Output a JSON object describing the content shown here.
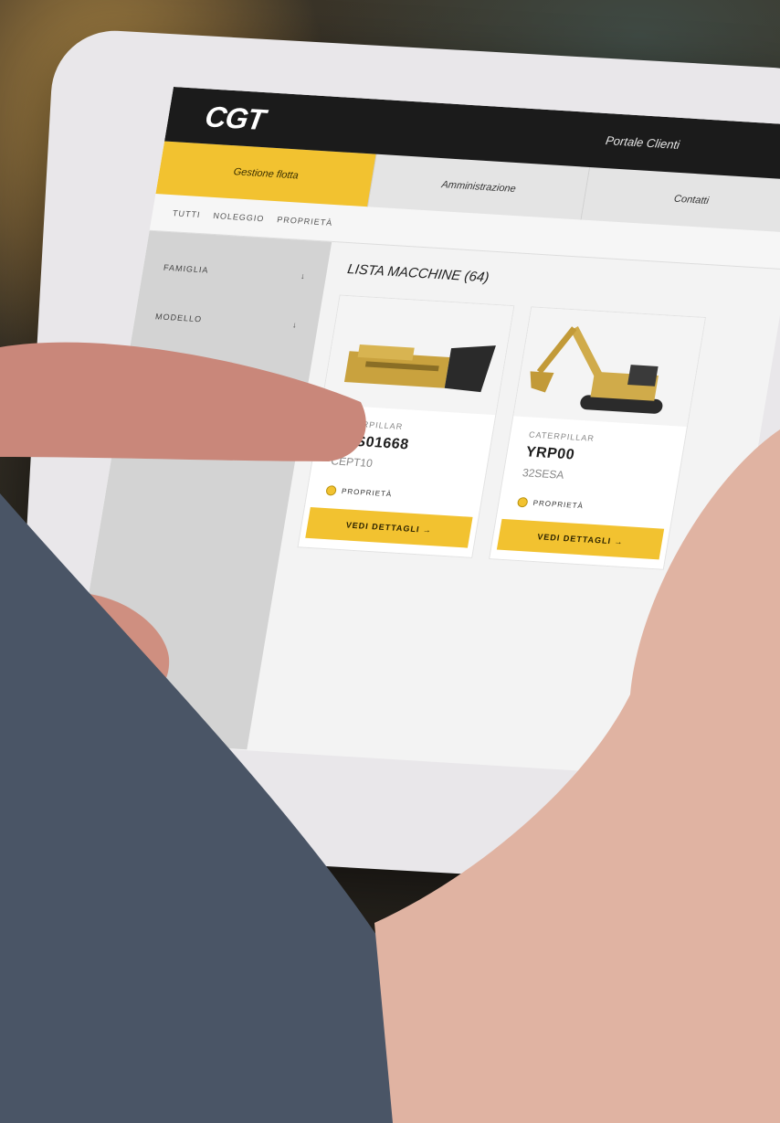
{
  "app": {
    "logo_text": "CGT",
    "portal_label": "Portale Clienti"
  },
  "nav": {
    "tabs": [
      {
        "label": "Gestione flotta",
        "active": true
      },
      {
        "label": "Amministrazione",
        "active": false
      },
      {
        "label": "Contatti",
        "active": false
      }
    ]
  },
  "breadcrumb": [
    "TUTTI",
    "NOLEGGIO",
    "PROPRIETÀ"
  ],
  "sidebar": {
    "filters": [
      {
        "label": "FAMIGLIA",
        "icon": "chevron-down-icon"
      },
      {
        "label": "MODELLO",
        "icon": "chevron-down-icon"
      }
    ]
  },
  "main": {
    "list_title": "LISTA MACCHINE (64)",
    "cards": [
      {
        "brand": "CATERPILLAR",
        "model": "RPS01668",
        "serial": "CEPT10",
        "tag": "PROPRIETÀ",
        "cta": "VEDI DETTAGLI"
      },
      {
        "brand": "CATERPILLAR",
        "model": "YRP00",
        "serial": "32SESA",
        "tag": "PROPRIETÀ",
        "cta": "VEDI DETTAGLI"
      }
    ]
  },
  "colors": {
    "accent": "#f2c230",
    "topbar": "#1b1b1b",
    "sidebar": "#d3d3d3"
  }
}
